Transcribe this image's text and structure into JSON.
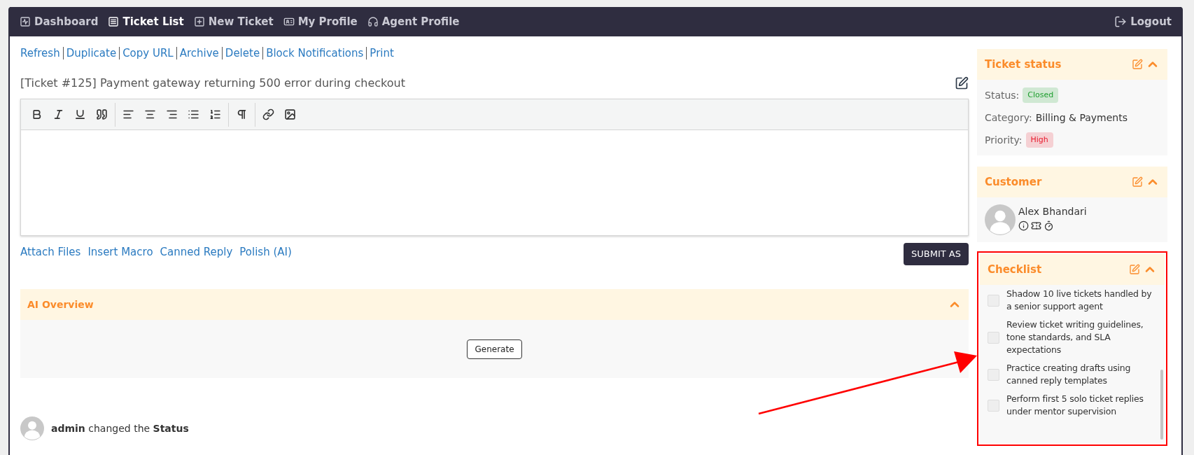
{
  "nav": {
    "items": [
      {
        "label": "Dashboard",
        "kind": "dashboard",
        "selected": false
      },
      {
        "label": "Ticket List",
        "kind": "list",
        "selected": true
      },
      {
        "label": "New Ticket",
        "kind": "new",
        "selected": false
      },
      {
        "label": "My Profile",
        "kind": "profile",
        "selected": false
      },
      {
        "label": "Agent Profile",
        "kind": "agent",
        "selected": false
      }
    ],
    "logout": "Logout"
  },
  "actions": [
    "Refresh",
    "Duplicate",
    "Copy URL",
    "Archive",
    "Delete",
    "Block Notifications",
    "Print"
  ],
  "ticket_title": "[Ticket #125] Payment gateway returning 500 error during checkout",
  "editor_links": [
    "Attach Files",
    "Insert Macro",
    "Canned Reply",
    "Polish (AI)"
  ],
  "submit": "SUBMIT AS",
  "ai_overview": {
    "title": "AI Overview",
    "expanded": true,
    "button": "Generate"
  },
  "activity": {
    "user": "admin",
    "text": "changed the",
    "field": "Status"
  },
  "ticket_status": {
    "title": "Ticket status",
    "expanded": true,
    "fields": [
      {
        "label": "Status:",
        "value": "Closed",
        "kind": "badge",
        "color": "#1e9e2e"
      },
      {
        "label": "Category:",
        "value": "Billing & Payments",
        "kind": "text"
      },
      {
        "label": "Priority:",
        "value": "High",
        "kind": "badge",
        "color": "#e8192c"
      }
    ]
  },
  "customer": {
    "title": "Customer",
    "expanded": true,
    "name": "Alex Bhandari"
  },
  "checklist": {
    "title": "Checklist",
    "expanded": true,
    "highlighted": true,
    "items": [
      {
        "text": "Shadow 10 live tickets handled by a senior support agent",
        "checked": false
      },
      {
        "text": "Review ticket writing guidelines, tone standards, and SLA expectations",
        "checked": false
      },
      {
        "text": "Practice creating drafts using canned reply templates",
        "checked": false
      },
      {
        "text": "Perform first 5 solo ticket replies under mentor supervision",
        "checked": false
      }
    ]
  }
}
